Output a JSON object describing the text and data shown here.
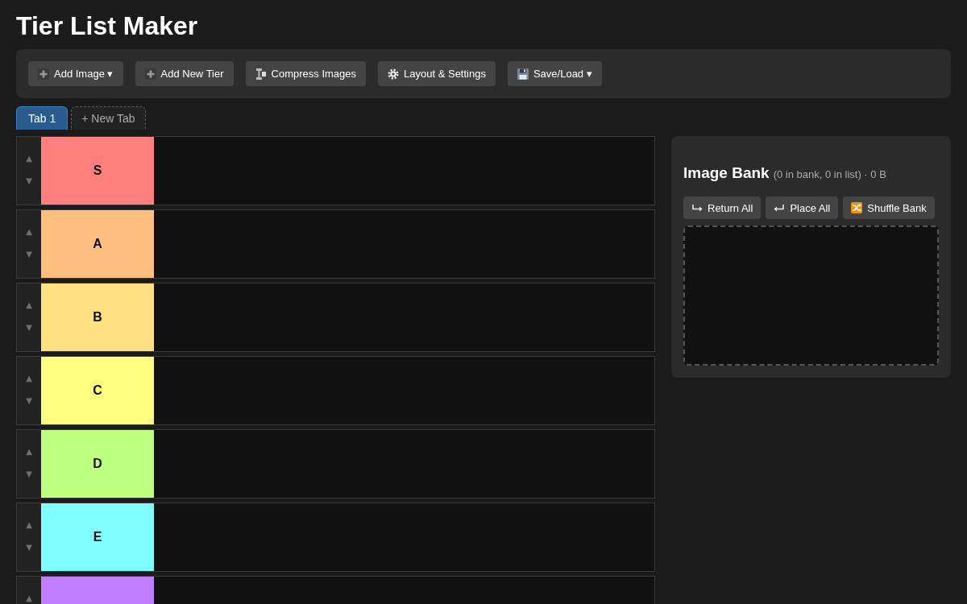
{
  "title": "Tier List Maker",
  "toolbar": {
    "buttons": [
      {
        "kind": "add",
        "label": "Add Image ▾"
      },
      {
        "kind": "add",
        "label": "Add New Tier"
      },
      {
        "kind": "compress",
        "label": "Compress Images"
      },
      {
        "kind": "settings",
        "label": "Layout & Settings"
      },
      {
        "kind": "save",
        "label": "Save/Load ▾"
      }
    ]
  },
  "tabs": [
    {
      "label": "Tab 1",
      "selected": true
    }
  ],
  "new_tab_button": "+ New Tab",
  "tiers": [
    {
      "label": "S",
      "color": "#ff7f7f",
      "up": "▲",
      "down": "▼"
    },
    {
      "label": "A",
      "color": "#ffbf7f",
      "up": "▲",
      "down": "▼"
    },
    {
      "label": "B",
      "color": "#ffdf7f",
      "up": "▲",
      "down": "▼"
    },
    {
      "label": "C",
      "color": "#ffff7f",
      "up": "▲",
      "down": "▼"
    },
    {
      "label": "D",
      "color": "#bfff7f",
      "up": "▲",
      "down": "▼"
    },
    {
      "label": "E",
      "color": "#7fffff",
      "up": "▲",
      "down": "▼"
    },
    {
      "color": "#bf7fff",
      "up": "▲"
    }
  ],
  "image_bank": {
    "title": "Image Bank",
    "stats": "(0 in bank, 0 in list) · 0 B",
    "buttons": [
      {
        "kind": "return",
        "label": "Return All"
      },
      {
        "kind": "place",
        "label": "Place All"
      },
      {
        "kind": "shuffle",
        "label": "Shuffle Bank"
      }
    ]
  }
}
